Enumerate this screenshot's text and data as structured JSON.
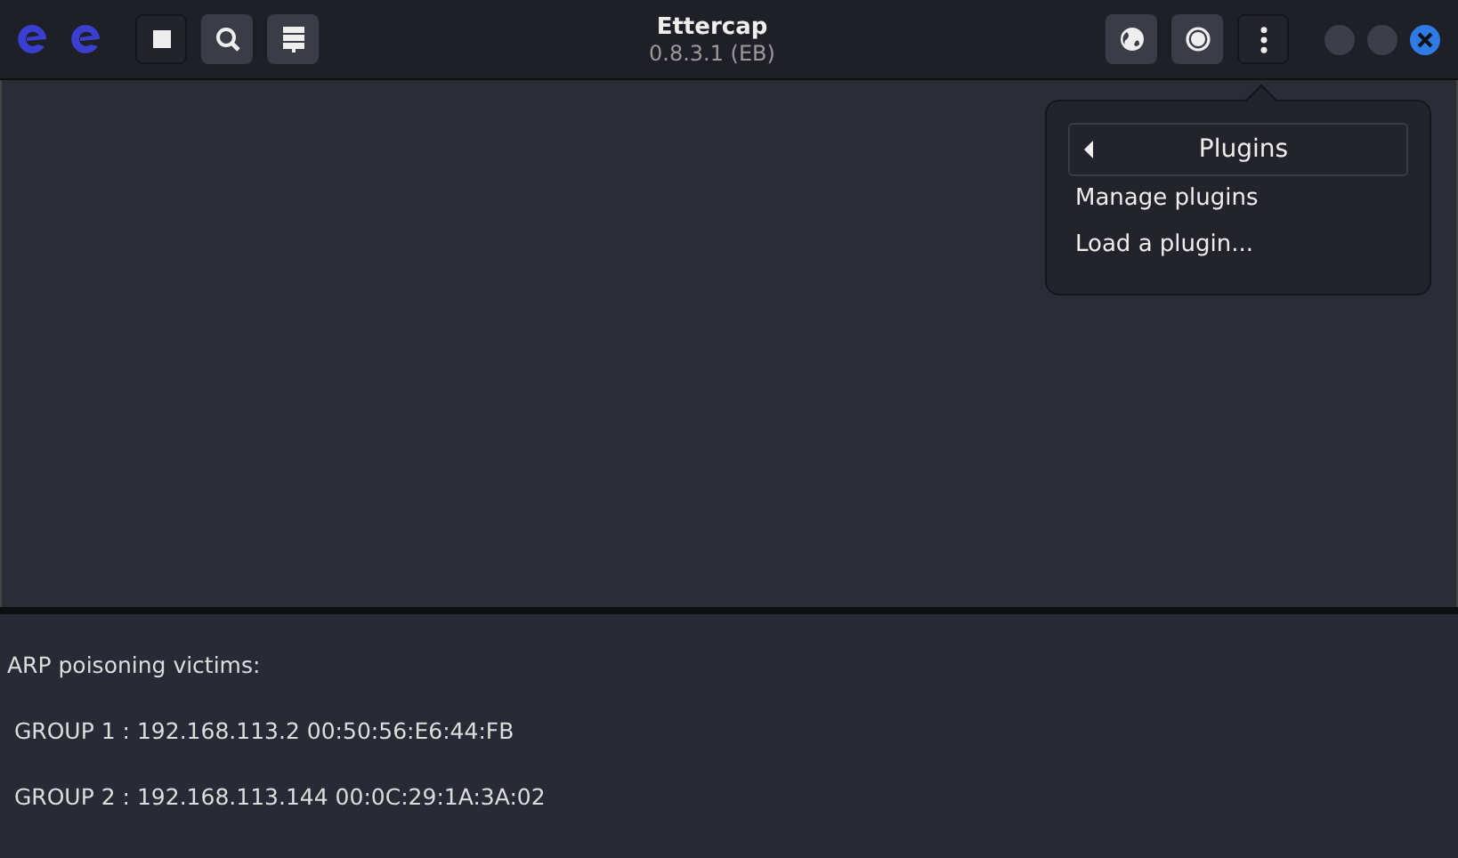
{
  "window": {
    "title": "Ettercap",
    "subtitle": "0.8.3.1 (EB)"
  },
  "toolbar_left": [
    {
      "kind": "stop",
      "active": true
    },
    {
      "kind": "search",
      "active": false
    },
    {
      "kind": "hosts",
      "active": false
    }
  ],
  "toolbar_right": [
    {
      "kind": "globe",
      "active": false
    },
    {
      "kind": "record",
      "active": false
    },
    {
      "kind": "menu",
      "active": true
    }
  ],
  "menu": {
    "header": "Plugins",
    "items": [
      "Manage plugins",
      "Load a plugin..."
    ]
  },
  "log": [
    "ARP poisoning victims:",
    " GROUP 1 : 192.168.113.2 00:50:56:E6:44:FB",
    " GROUP 2 : 192.168.113.144 00:0C:29:1A:3A:02"
  ]
}
